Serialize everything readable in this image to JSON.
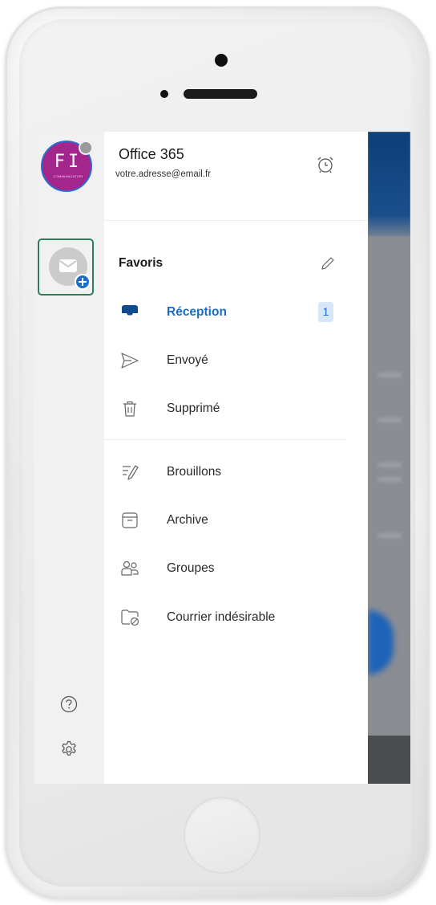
{
  "account": {
    "name": "Office 365",
    "email": "votre.adresse@email.fr",
    "avatar_logo": "FI",
    "avatar_subtext": "COMMUNICATION"
  },
  "favorites": {
    "title": "Favoris"
  },
  "folders": [
    {
      "label": "Réception",
      "icon": "inbox-icon",
      "active": true,
      "count": "1"
    },
    {
      "label": "Envoyé",
      "icon": "send-icon"
    },
    {
      "label": "Supprimé",
      "icon": "trash-icon"
    },
    {
      "label": "Brouillons",
      "icon": "drafts-icon"
    },
    {
      "label": "Archive",
      "icon": "archive-icon"
    },
    {
      "label": "Groupes",
      "icon": "groups-icon"
    },
    {
      "label": "Courrier indésirable",
      "icon": "junk-icon"
    }
  ],
  "colors": {
    "accent": "#1a6cc8",
    "highlight_box": "#2f7d5a",
    "arrow": "#3a9a6e",
    "avatar_bg": "#a4268c"
  },
  "icons": {
    "rail_bottom": [
      "help-icon",
      "settings-icon"
    ],
    "header": "alarm-icon",
    "favorites_edit": "edit-pencil-icon"
  }
}
